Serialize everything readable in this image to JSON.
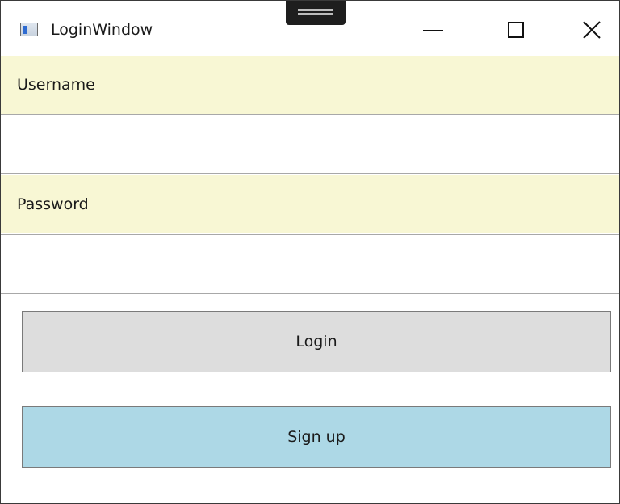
{
  "window": {
    "title": "LoginWindow",
    "icon": "app-window-icon"
  },
  "caption_buttons": {
    "minimize": "minimize-icon",
    "maximize": "maximize-icon",
    "close": "close-icon"
  },
  "form": {
    "username_label": "Username",
    "username_value": "",
    "password_label": "Password",
    "password_value": ""
  },
  "buttons": {
    "login_label": "Login",
    "signup_label": "Sign up"
  },
  "colors": {
    "label_background": "#f8f7d4",
    "login_background": "#dddddd",
    "signup_background": "#add8e6"
  }
}
